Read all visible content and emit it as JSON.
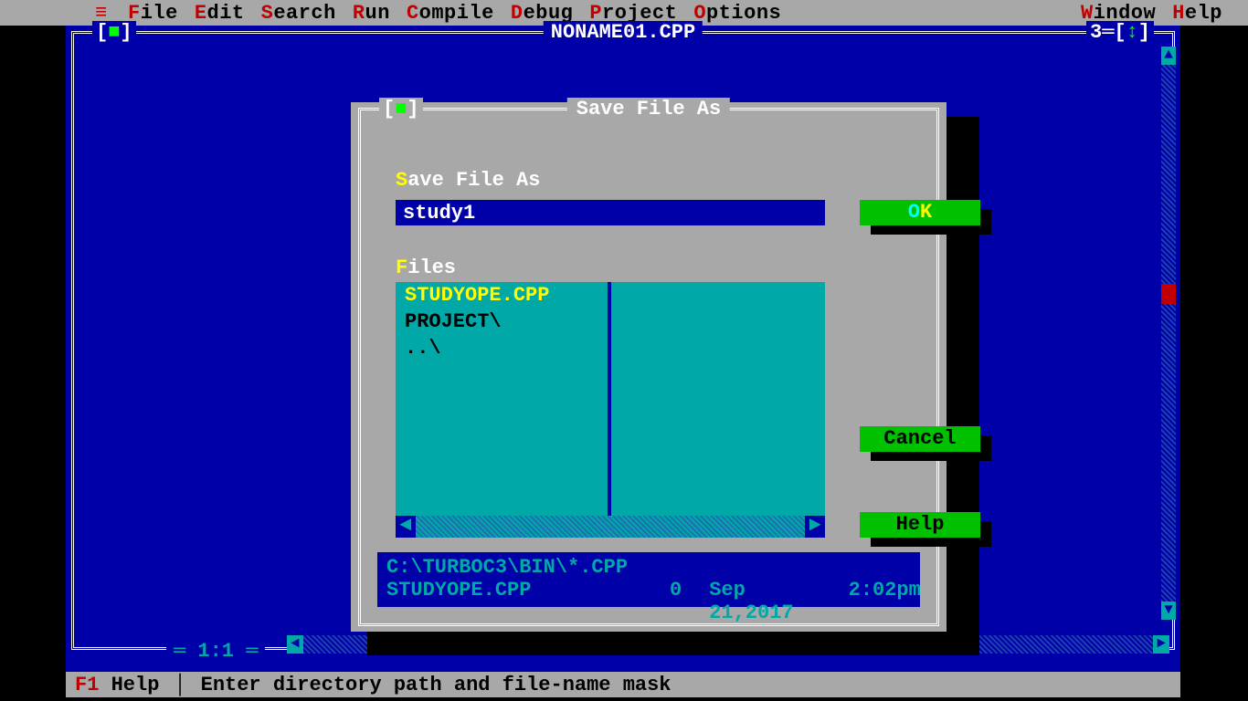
{
  "menu": {
    "items": [
      {
        "hot": "F",
        "rest": "ile"
      },
      {
        "hot": "E",
        "rest": "dit"
      },
      {
        "hot": "S",
        "rest": "earch"
      },
      {
        "hot": "R",
        "rest": "un"
      },
      {
        "hot": "C",
        "rest": "ompile"
      },
      {
        "hot": "D",
        "rest": "ebug"
      },
      {
        "hot": "P",
        "rest": "roject"
      },
      {
        "hot": "O",
        "rest": "ptions"
      }
    ],
    "right": [
      {
        "hot": "W",
        "rest": "indow"
      },
      {
        "hot": "H",
        "rest": "elp"
      }
    ],
    "hamburger": "≡"
  },
  "editor": {
    "title": "NONAME01.CPP",
    "close": "[■]",
    "window_number": "3",
    "zoom": "↕",
    "cursor_pos": "1:1"
  },
  "dialog": {
    "title": "Save File As",
    "close": "[■]",
    "filename_label_hot": "S",
    "filename_label_rest": "ave File As",
    "filename_value": "study1",
    "files_label_hot": "F",
    "files_label_rest": "iles",
    "files": [
      {
        "name": "STUDYOPE.CPP",
        "selected": true
      },
      {
        "name": "PROJECT\\",
        "selected": false
      },
      {
        "name": "..\\",
        "selected": false
      }
    ],
    "buttons": {
      "ok_hot": "O",
      "ok_rest": "K",
      "cancel": "Cancel",
      "help": "Help"
    },
    "info": {
      "path": "C:\\TURBOC3\\BIN\\*.CPP",
      "filename": "STUDYOPE.CPP",
      "size": "0",
      "date": "Sep 21,2017",
      "time": "2:02pm"
    }
  },
  "status": {
    "key": "F1",
    "key_label": "Help",
    "hint": "Enter directory path and file-name mask"
  }
}
